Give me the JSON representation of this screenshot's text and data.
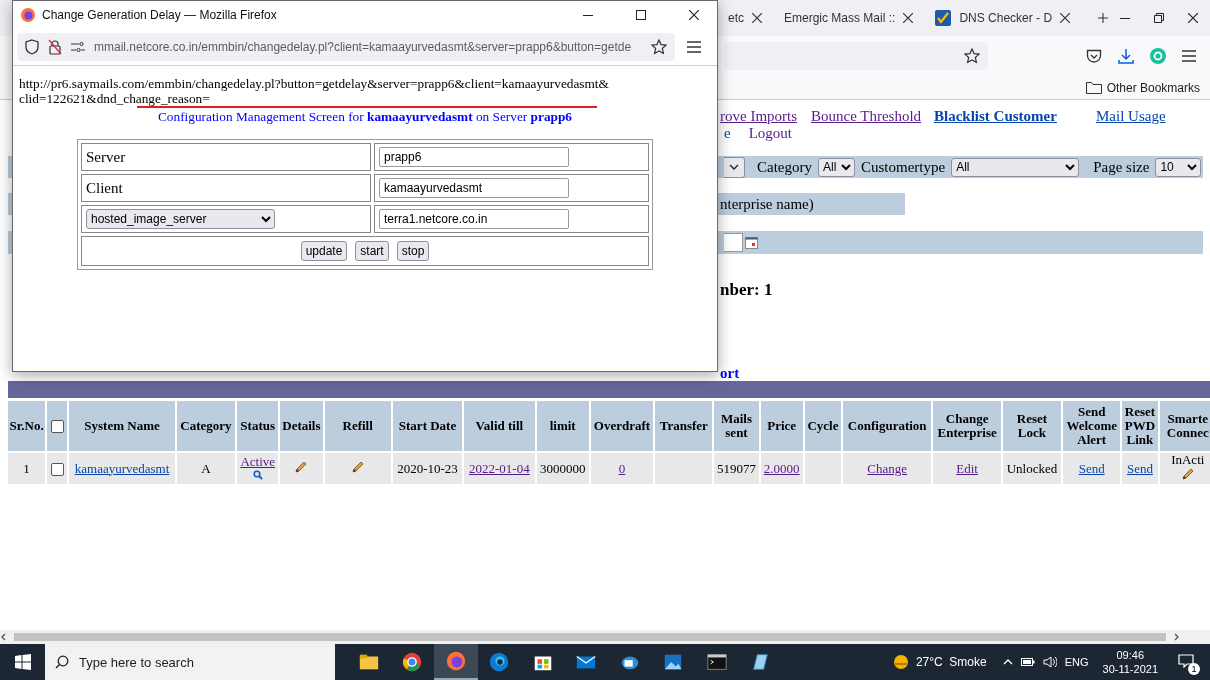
{
  "popup": {
    "title": "Change Generation Delay — Mozilla Firefox",
    "url": "mmail.netcore.co.in/emmbin/changedelay.pl?client=kamaayurvedasmt&server=prapp6&button=getde",
    "link_text": "http://pr6.saymails.com/emmbin/changedelay.pl?button=getdelay&server=prapp6&client=kamaayurvedasmt&clid=122621&dnd_change_reason=",
    "heading": "Configuration Management Screen for **kamaayurvedasmt** on Server **prapp6**",
    "form_rows": [
      {
        "kind": "label",
        "label": "Server",
        "value": "prapp6"
      },
      {
        "kind": "label",
        "label": "Client",
        "value": "kamaayurvedasmt"
      },
      {
        "kind": "select",
        "label": "hosted_image_server",
        "value": "terra1.netcore.co.in"
      }
    ],
    "buttons": [
      "update",
      "start",
      "stop"
    ]
  },
  "browser": {
    "tabs": [
      {
        "label": "etc",
        "selected": false
      },
      {
        "label": "Emergic Mass Mail ::",
        "selected": false
      },
      {
        "label": "DNS Checker - D",
        "selected": false
      }
    ],
    "bookmarks": [
      "Other Bookmarks"
    ]
  },
  "page": {
    "nav_links": [
      {
        "label": "rove Imports",
        "visited": true,
        "bold": false
      },
      {
        "label": "Bounce Threshold",
        "visited": true,
        "bold": false
      },
      {
        "label": "Blacklist Customer",
        "visited": false,
        "bold": true
      },
      {
        "label": "Mail Usage",
        "visited": false,
        "bold": false
      },
      {
        "label": "e",
        "visited": false,
        "bold": false
      },
      {
        "label": "Logout",
        "visited": true,
        "bold": false
      }
    ],
    "filters": [
      {
        "label": "Category",
        "value": "All"
      },
      {
        "label": "Customertype",
        "value": "All"
      },
      {
        "label": "Page size",
        "value": "10"
      }
    ],
    "enterprise_note": "nterprise name)",
    "count_text": "nber: 1",
    "report_link": "ort",
    "table": {
      "columns": [
        {
          "kind": "text",
          "label": "Sr.No."
        },
        {
          "kind": "checkbox",
          "checked": false
        },
        {
          "kind": "text",
          "label": "System Name"
        },
        {
          "kind": "text",
          "label": "Category"
        },
        {
          "kind": "text",
          "label": "Status"
        },
        {
          "kind": "text",
          "label": "Details"
        },
        {
          "kind": "text",
          "label": "Refill"
        },
        {
          "kind": "text",
          "label": "Start Date"
        },
        {
          "kind": "text",
          "label": "Valid till"
        },
        {
          "kind": "text",
          "label": "limit"
        },
        {
          "kind": "text",
          "label": "Overdraft"
        },
        {
          "kind": "text",
          "label": "Transfer"
        },
        {
          "kind": "text",
          "label": "Mails sent"
        },
        {
          "kind": "text",
          "label": "Price"
        },
        {
          "kind": "text",
          "label": "Cycle"
        },
        {
          "kind": "text",
          "label": "Configuration"
        },
        {
          "kind": "text",
          "label": "Change Enterprise"
        },
        {
          "kind": "text",
          "label": "Reset Lock"
        },
        {
          "kind": "text",
          "label": "Send Welcome Alert"
        },
        {
          "kind": "text",
          "label": "Reset PWD Link"
        },
        {
          "kind": "text",
          "label": "Smarte Connec"
        }
      ],
      "rows": [
        {
          "cells": [
            {
              "kind": "text",
              "text": "1"
            },
            {
              "kind": "checkbox",
              "checked": false
            },
            {
              "kind": "link",
              "text": "kamaayurvedasmt",
              "visited": false
            },
            {
              "kind": "text",
              "text": "A"
            },
            {
              "kind": "status",
              "text": "Active",
              "visited": true
            },
            {
              "kind": "edit"
            },
            {
              "kind": "edit"
            },
            {
              "kind": "text",
              "text": "2020-10-23"
            },
            {
              "kind": "link",
              "text": "2022-01-04",
              "visited": true
            },
            {
              "kind": "text",
              "text": "3000000"
            },
            {
              "kind": "link",
              "text": "0",
              "visited": true
            },
            {
              "kind": "empty"
            },
            {
              "kind": "text",
              "text": "519077"
            },
            {
              "kind": "link",
              "text": "2.0000",
              "visited": true
            },
            {
              "kind": "empty"
            },
            {
              "kind": "link",
              "text": "Change",
              "visited": true
            },
            {
              "kind": "link",
              "text": "Edit",
              "visited": true
            },
            {
              "kind": "text",
              "text": "Unlocked"
            },
            {
              "kind": "link",
              "text": "Send",
              "visited": false
            },
            {
              "kind": "link",
              "text": "Send",
              "visited": false
            },
            {
              "kind": "edit_text",
              "text": "InActi"
            }
          ]
        }
      ]
    }
  },
  "taskbar": {
    "search_placeholder": "Type here to search",
    "weather": "27°C  Smoke",
    "language": "ENG",
    "time": "09:46",
    "date": "30-11-2021",
    "notifications": "1"
  }
}
